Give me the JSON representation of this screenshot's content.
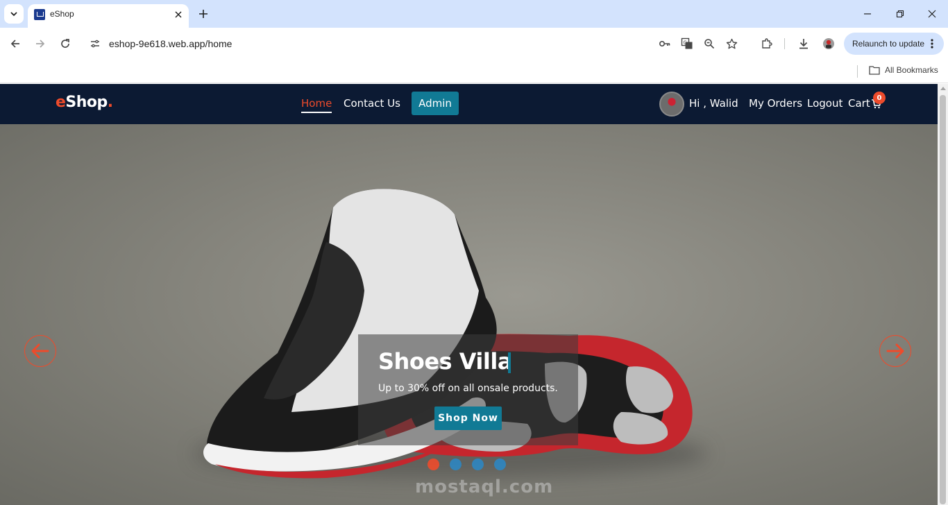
{
  "browser": {
    "tab": {
      "title": "eShop"
    },
    "url": "eshop-9e618.web.app/home",
    "relaunch_label": "Relaunch to update",
    "bookmarks_label": "All Bookmarks"
  },
  "nav": {
    "logo_e": "e",
    "logo_rest": "Shop",
    "logo_dot": ".",
    "links": [
      {
        "label": "Home"
      },
      {
        "label": "Contact Us"
      },
      {
        "label": "Admin"
      }
    ],
    "greeting": "Hi , Walid",
    "my_orders": "My Orders",
    "logout": "Logout",
    "cart_label": "Cart",
    "cart_count": "0"
  },
  "hero": {
    "title": "Shoes Villa",
    "subtitle": "Up to 30% off on all onsale products.",
    "button_label": "Shop Now",
    "slide_count": 4,
    "active_slide": 0
  },
  "watermark": {
    "text": "mostaql.com"
  },
  "colors": {
    "accent": "#ee4b2b",
    "primary": "#117a95",
    "navbar": "#0c1a33",
    "chrome_tab_bg": "#d3e3fd"
  },
  "icons": {
    "nav_back": "arrow-left-icon",
    "nav_forward": "arrow-right-icon",
    "reload": "reload-icon",
    "site_info": "tune-icon",
    "password": "key-icon",
    "translate": "translate-icon",
    "zoom": "zoom-icon",
    "bookmark": "star-icon",
    "extensions": "puzzle-icon",
    "downloads": "download-icon",
    "profile": "avatar-icon",
    "folder": "folder-icon",
    "cart": "cart-icon"
  }
}
